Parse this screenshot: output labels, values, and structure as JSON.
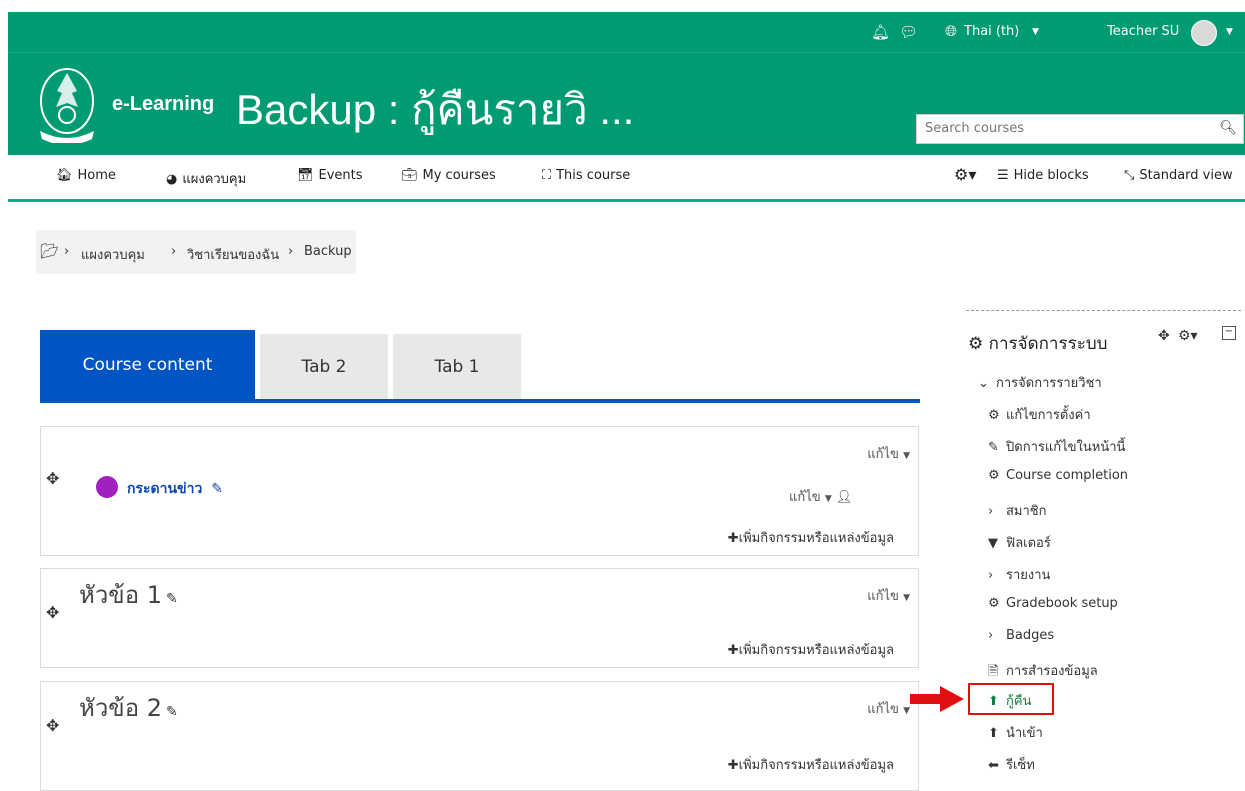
{
  "topbar": {
    "language": "Thai (th)",
    "user_name": "Teacher SU"
  },
  "header": {
    "brand": "e-Learning",
    "course_title": "Backup : กู้คืนรายวิ ...",
    "search_placeholder": "Search courses"
  },
  "nav": {
    "items": [
      {
        "icon": "home-icon",
        "label": "Home"
      },
      {
        "icon": "dashboard-icon",
        "label": "แผงควบคุม"
      },
      {
        "icon": "calendar-icon",
        "label": "Events"
      },
      {
        "icon": "briefcase-icon",
        "label": "My courses"
      },
      {
        "icon": "sitemap-icon",
        "label": "This course"
      }
    ],
    "hide_blocks": "Hide blocks",
    "standard_view": "Standard view"
  },
  "breadcrumb": [
    "แผงควบคุม",
    "วิชาเรียนของฉัน",
    "Backup"
  ],
  "tabs": [
    "Course content",
    "Tab 2",
    "Tab 1"
  ],
  "sections": [
    {
      "title": "",
      "edit": "แก้ไข",
      "activity": {
        "name": "กระดานข่าว",
        "edit": "แก้ไข"
      },
      "add": "เพิ่มกิจกรรมหรือแหล่งข้อมูล"
    },
    {
      "title": "หัวข้อ 1",
      "edit": "แก้ไข",
      "add": "เพิ่มกิจกรรมหรือแหล่งข้อมูล"
    },
    {
      "title": "หัวข้อ 2",
      "edit": "แก้ไข",
      "add": "เพิ่มกิจกรรมหรือแหล่งข้อมูล"
    }
  ],
  "admin_block": {
    "title": "การจัดการระบบ",
    "items": [
      {
        "icon": "chevron-down-icon",
        "label": "การจัดการรายวิชา"
      },
      {
        "icon": "gear-icon",
        "label": "แก้ไขการตั้งค่า"
      },
      {
        "icon": "pencil-icon",
        "label": "ปิดการแก้ไขในหน้านี้"
      },
      {
        "icon": "gear-icon",
        "label": "Course completion"
      },
      {
        "icon": "chevron-right-icon",
        "label": "สมาชิก"
      },
      {
        "icon": "filter-icon",
        "label": "ฟิลเตอร์"
      },
      {
        "icon": "chevron-right-icon",
        "label": "รายงาน"
      },
      {
        "icon": "gear-icon",
        "label": "Gradebook setup"
      },
      {
        "icon": "chevron-right-icon",
        "label": "Badges"
      },
      {
        "icon": "file-archive-icon",
        "label": "การสำรองข้อมูล"
      },
      {
        "icon": "upload-icon",
        "label": "กู้คืน"
      },
      {
        "icon": "upload-icon",
        "label": "นำเข้า"
      },
      {
        "icon": "arrow-left-icon",
        "label": "รีเซ็ท"
      }
    ]
  },
  "colors": {
    "header_green": "#009b73",
    "tab_blue": "#0055c4",
    "highlight_red": "#e01010",
    "restore_green": "#0a7f3f"
  }
}
